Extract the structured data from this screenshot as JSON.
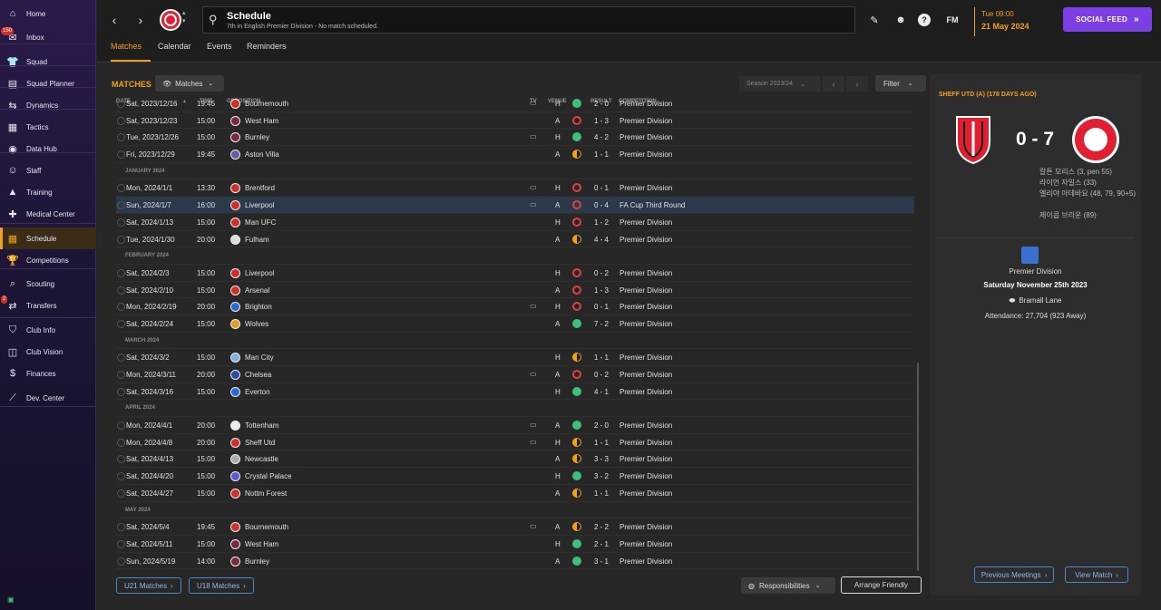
{
  "sidebar": {
    "items": [
      {
        "label": "Home",
        "icon": "home-icon",
        "glyph": "⌂"
      },
      {
        "label": "Inbox",
        "icon": "inbox-icon",
        "glyph": "✉",
        "badge": "150"
      },
      {
        "label": "Squad",
        "icon": "shirt-icon",
        "glyph": "👕"
      },
      {
        "label": "Squad Planner",
        "icon": "planner-icon",
        "glyph": "▤"
      },
      {
        "label": "Dynamics",
        "icon": "dynamics-icon",
        "glyph": "⇆"
      },
      {
        "label": "Tactics",
        "icon": "tactics-icon",
        "glyph": "▦"
      },
      {
        "label": "Data Hub",
        "icon": "data-hub-icon",
        "glyph": "◉"
      },
      {
        "label": "Staff",
        "icon": "staff-icon",
        "glyph": "☺"
      },
      {
        "label": "Training",
        "icon": "training-icon",
        "glyph": "▲"
      },
      {
        "label": "Medical Center",
        "icon": "medical-icon",
        "glyph": "✚"
      },
      {
        "label": "Schedule",
        "icon": "calendar-icon",
        "glyph": "▦",
        "active": true
      },
      {
        "label": "Competitions",
        "icon": "trophy-icon",
        "glyph": "🏆"
      },
      {
        "label": "Scouting",
        "icon": "scouting-icon",
        "glyph": "⌕"
      },
      {
        "label": "Transfers",
        "icon": "transfers-icon",
        "glyph": "⇄",
        "badge": "2"
      },
      {
        "label": "Club Info",
        "icon": "club-info-icon",
        "glyph": "⛉"
      },
      {
        "label": "Club Vision",
        "icon": "club-vision-icon",
        "glyph": "◫"
      },
      {
        "label": "Finances",
        "icon": "finances-icon",
        "glyph": "$"
      },
      {
        "label": "Dev. Center",
        "icon": "dev-center-icon",
        "glyph": "⟋"
      }
    ]
  },
  "header": {
    "title": "Schedule",
    "subtitle": "7th in English Premier Division - No match scheduled.",
    "time": "Tue 09:00",
    "date": "21 May 2024",
    "social_feed": "SOCIAL FEED",
    "fm_label": "FM",
    "tabs": [
      {
        "label": "Matches",
        "active": true
      },
      {
        "label": "Calendar"
      },
      {
        "label": "Events"
      },
      {
        "label": "Reminders"
      }
    ]
  },
  "main": {
    "title": "MATCHES",
    "view_dropdown": "Matches",
    "season": "Season 2023/24",
    "filter": "Filter",
    "columns": {
      "date": "DATE",
      "time": "TIME",
      "opposition": "OPPOSITION",
      "tv": "TV",
      "venue": "VENUE",
      "result": "RESULT",
      "competition": "COMPETITION"
    },
    "u21": "U21 Matches",
    "u18": "U18 Matches",
    "responsibilities": "Responsibilities",
    "arrange_friendly": "Arrange Friendly"
  },
  "colors": {
    "win": "#3fc07a",
    "draw": "#f0a020",
    "loss": "#e04040",
    "accent": "#f0a020",
    "brand": "#7b3fe4"
  },
  "matches": [
    {
      "date": "Sat, 2023/12/16",
      "time": "19:45",
      "opp": "Bournemouth",
      "tv": true,
      "venue": "H",
      "outcome": "win",
      "result": "2 - 0",
      "comp": "Premier Division",
      "crest": "#d0302a"
    },
    {
      "date": "Sat, 2023/12/23",
      "time": "15:00",
      "opp": "West Ham",
      "tv": false,
      "venue": "A",
      "outcome": "loss",
      "result": "1 - 3",
      "comp": "Premier Division",
      "crest": "#7a2a40"
    },
    {
      "date": "Tue, 2023/12/26",
      "time": "15:00",
      "opp": "Burnley",
      "tv": true,
      "venue": "H",
      "outcome": "win",
      "result": "4 - 2",
      "comp": "Premier Division",
      "crest": "#7a2a40"
    },
    {
      "date": "Fri, 2023/12/29",
      "time": "19:45",
      "opp": "Aston Villa",
      "tv": false,
      "venue": "A",
      "outcome": "draw",
      "result": "1 - 1",
      "comp": "Premier Division",
      "crest": "#6a5aa0"
    },
    {
      "month": "JANUARY 2024"
    },
    {
      "date": "Mon, 2024/1/1",
      "time": "13:30",
      "opp": "Brentford",
      "tv": true,
      "venue": "H",
      "outcome": "loss",
      "result": "0 - 1",
      "comp": "Premier Division",
      "crest": "#d0302a"
    },
    {
      "date": "Sun, 2024/1/7",
      "time": "16:00",
      "opp": "Liverpool",
      "tv": true,
      "venue": "A",
      "outcome": "loss",
      "result": "0 - 4",
      "comp": "FA Cup Third Round",
      "crest": "#d0302a",
      "selected": true
    },
    {
      "date": "Sat, 2024/1/13",
      "time": "15:00",
      "opp": "Man UFC",
      "tv": false,
      "venue": "H",
      "outcome": "loss",
      "result": "1 - 2",
      "comp": "Premier Division",
      "crest": "#d0302a"
    },
    {
      "date": "Tue, 2024/1/30",
      "time": "20:00",
      "opp": "Fulham",
      "tv": false,
      "venue": "A",
      "outcome": "draw",
      "result": "4 - 4",
      "comp": "Premier Division",
      "crest": "#dddddd"
    },
    {
      "month": "FEBRUARY 2024"
    },
    {
      "date": "Sat, 2024/2/3",
      "time": "15:00",
      "opp": "Liverpool",
      "tv": false,
      "venue": "H",
      "outcome": "loss",
      "result": "0 - 2",
      "comp": "Premier Division",
      "crest": "#d0302a"
    },
    {
      "date": "Sat, 2024/2/10",
      "time": "15:00",
      "opp": "Arsenal",
      "tv": false,
      "venue": "A",
      "outcome": "loss",
      "result": "1 - 3",
      "comp": "Premier Division",
      "crest": "#d0302a"
    },
    {
      "date": "Mon, 2024/2/19",
      "time": "20:00",
      "opp": "Brighton",
      "tv": true,
      "venue": "H",
      "outcome": "loss",
      "result": "0 - 1",
      "comp": "Premier Division",
      "crest": "#2a6ad0"
    },
    {
      "date": "Sat, 2024/2/24",
      "time": "15:00",
      "opp": "Wolves",
      "tv": false,
      "venue": "A",
      "outcome": "win",
      "result": "7 - 2",
      "comp": "Premier Division",
      "crest": "#e0a020"
    },
    {
      "month": "MARCH 2024"
    },
    {
      "date": "Sat, 2024/3/2",
      "time": "15:00",
      "opp": "Man City",
      "tv": false,
      "venue": "H",
      "outcome": "draw",
      "result": "1 - 1",
      "comp": "Premier Division",
      "crest": "#7ab0e0"
    },
    {
      "date": "Mon, 2024/3/11",
      "time": "20:00",
      "opp": "Chelsea",
      "tv": true,
      "venue": "A",
      "outcome": "loss",
      "result": "0 - 2",
      "comp": "Premier Division",
      "crest": "#2a4ab0"
    },
    {
      "date": "Sat, 2024/3/16",
      "time": "15:00",
      "opp": "Everton",
      "tv": false,
      "venue": "H",
      "outcome": "win",
      "result": "4 - 1",
      "comp": "Premier Division",
      "crest": "#2a6ad0"
    },
    {
      "month": "APRIL 2024"
    },
    {
      "date": "Mon, 2024/4/1",
      "time": "20:00",
      "opp": "Tottenham",
      "tv": true,
      "venue": "A",
      "outcome": "win",
      "result": "2 - 0",
      "comp": "Premier Division",
      "crest": "#eeeeee"
    },
    {
      "date": "Mon, 2024/4/8",
      "time": "20:00",
      "opp": "Sheff Utd",
      "tv": true,
      "venue": "H",
      "outcome": "draw",
      "result": "1 - 1",
      "comp": "Premier Division",
      "crest": "#d0302a"
    },
    {
      "date": "Sat, 2024/4/13",
      "time": "15:00",
      "opp": "Newcastle",
      "tv": false,
      "venue": "A",
      "outcome": "draw",
      "result": "3 - 3",
      "comp": "Premier Division",
      "crest": "#aaaaaa"
    },
    {
      "date": "Sat, 2024/4/20",
      "time": "15:00",
      "opp": "Crystal Palace",
      "tv": false,
      "venue": "H",
      "outcome": "win",
      "result": "3 - 2",
      "comp": "Premier Division",
      "crest": "#5a5ad0"
    },
    {
      "date": "Sat, 2024/4/27",
      "time": "15:00",
      "opp": "Nottm Forest",
      "tv": false,
      "venue": "A",
      "outcome": "draw",
      "result": "1 - 1",
      "comp": "Premier Division",
      "crest": "#d0302a"
    },
    {
      "month": "MAY 2024"
    },
    {
      "date": "Sat, 2024/5/4",
      "time": "19:45",
      "opp": "Bournemouth",
      "tv": true,
      "venue": "A",
      "outcome": "draw",
      "result": "2 - 2",
      "comp": "Premier Division",
      "crest": "#d0302a"
    },
    {
      "date": "Sat, 2024/5/11",
      "time": "15:00",
      "opp": "West Ham",
      "tv": false,
      "venue": "H",
      "outcome": "win",
      "result": "2 - 1",
      "comp": "Premier Division",
      "crest": "#7a2a40"
    },
    {
      "date": "Sun, 2024/5/19",
      "time": "14:00",
      "opp": "Burnley",
      "tv": false,
      "venue": "A",
      "outcome": "win",
      "result": "3 - 1",
      "comp": "Premier Division",
      "crest": "#7a2a40"
    }
  ],
  "panel": {
    "title": "SHEFF UTD (A) (178 DAYS AGO)",
    "score": "0 - 7",
    "scorers": [
      "칼튼 모리스 (3, pen 55)",
      "라이언 자일스 (33)",
      "엘리야 아데바요 (48, 79, 90+5)",
      "제이콥 브라운 (89)"
    ],
    "competition": "Premier Division",
    "date": "Saturday November 25th 2023",
    "stadium": "Bramall Lane",
    "attendance": "Attendance: 27,704 (923 Away)",
    "prev_meetings": "Previous Meetings",
    "view_match": "View Match"
  }
}
